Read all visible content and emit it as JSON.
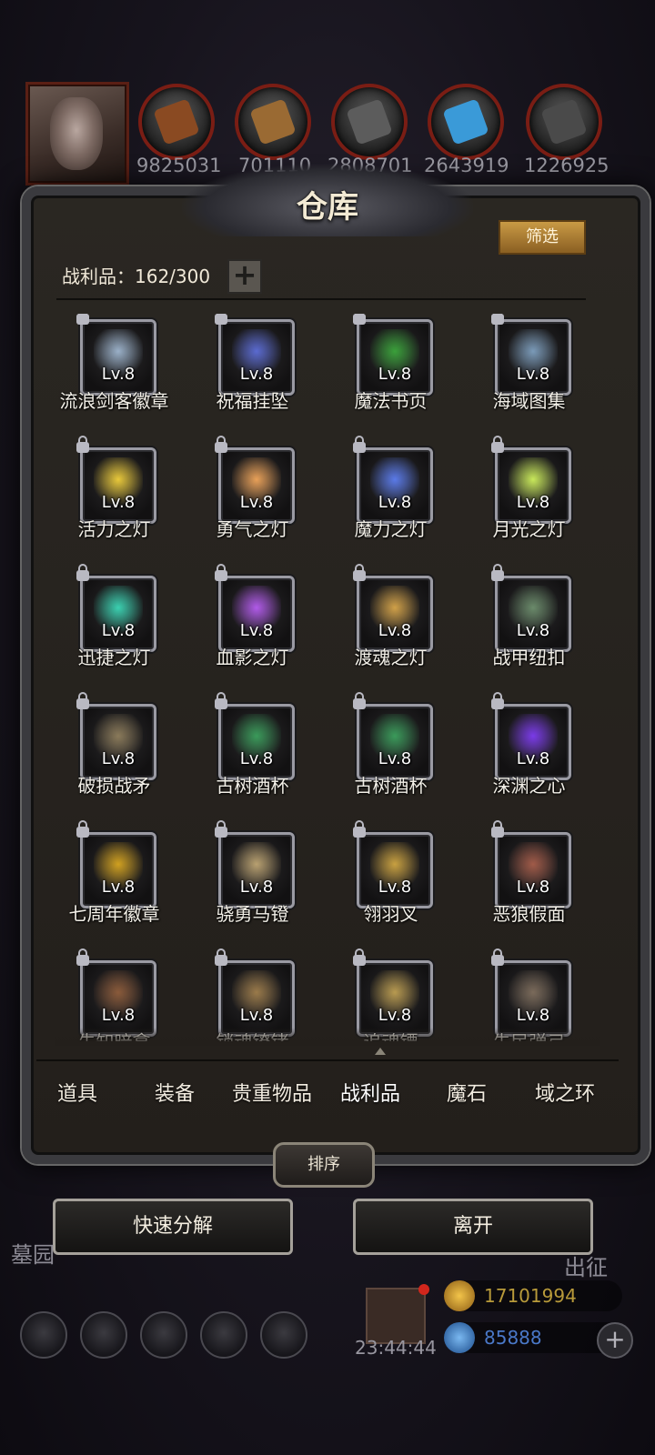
{
  "resources": [
    {
      "name": "meat-icon",
      "value": "9825031",
      "color": "#8a4a22"
    },
    {
      "name": "wood-icon",
      "value": "701110",
      "color": "#9a6a33"
    },
    {
      "name": "iron-icon",
      "value": "2808701",
      "color": "#5c5c5c"
    },
    {
      "name": "crystal-icon",
      "value": "2643919",
      "color": "#3a9ad8"
    },
    {
      "name": "steel-icon",
      "value": "1226925",
      "color": "#4a4a4a"
    }
  ],
  "panel": {
    "title": "仓库",
    "filter_label": "筛选",
    "count_label": "战利品：162/300",
    "plus_label": "+"
  },
  "items": [
    {
      "name": "流浪剑客徽章",
      "level": "Lv.8",
      "icon": "badge-icon",
      "color": "#9ab0c8"
    },
    {
      "name": "祝福挂坠",
      "level": "Lv.8",
      "icon": "pendant-icon",
      "color": "#5a6ad0"
    },
    {
      "name": "魔法书页",
      "level": "Lv.8",
      "icon": "spell-page-icon",
      "color": "#3aa03a"
    },
    {
      "name": "海域图集",
      "level": "Lv.8",
      "icon": "atlas-icon",
      "color": "#7a9ab8"
    },
    {
      "name": "活力之灯",
      "level": "Lv.8",
      "icon": "lantern-icon",
      "color": "#e8c83a"
    },
    {
      "name": "勇气之灯",
      "level": "Lv.8",
      "icon": "lantern-icon",
      "color": "#e8a058"
    },
    {
      "name": "魔力之灯",
      "level": "Lv.8",
      "icon": "lantern-icon",
      "color": "#5a7ae8"
    },
    {
      "name": "月光之灯",
      "level": "Lv.8",
      "icon": "lantern-icon",
      "color": "#c8e85a"
    },
    {
      "name": "迅捷之灯",
      "level": "Lv.8",
      "icon": "lantern-icon",
      "color": "#3ad0b0"
    },
    {
      "name": "血影之灯",
      "level": "Lv.8",
      "icon": "lantern-icon",
      "color": "#b05ae8"
    },
    {
      "name": "渡魂之灯",
      "level": "Lv.8",
      "icon": "lantern-icon",
      "color": "#d0a048"
    },
    {
      "name": "战甲纽扣",
      "level": "Lv.8",
      "icon": "armor-button-icon",
      "color": "#6a8a6a"
    },
    {
      "name": "破损战矛",
      "level": "Lv.8",
      "icon": "spear-icon",
      "color": "#8a7a5a"
    },
    {
      "name": "古树酒杯",
      "level": "Lv.8",
      "icon": "goblet-icon",
      "color": "#3a9a5a"
    },
    {
      "name": "古树酒杯",
      "level": "Lv.8",
      "icon": "goblet-icon",
      "color": "#3a9a5a"
    },
    {
      "name": "深渊之心",
      "level": "Lv.8",
      "icon": "abyss-heart-icon",
      "color": "#7a3ae8"
    },
    {
      "name": "七周年徽章",
      "level": "Lv.8",
      "icon": "anniversary-badge-icon",
      "color": "#d0a020"
    },
    {
      "name": "骁勇马镫",
      "level": "Lv.8",
      "icon": "stirrup-icon",
      "color": "#b8a070"
    },
    {
      "name": "翎羽叉",
      "level": "Lv.8",
      "icon": "fork-icon",
      "color": "#c8a040"
    },
    {
      "name": "恶狼假面",
      "level": "Lv.8",
      "icon": "wolf-mask-icon",
      "color": "#a05a48"
    },
    {
      "name": "先知暗拿",
      "level": "Lv.8",
      "icon": "tome-icon",
      "color": "#8a5a3a"
    },
    {
      "name": "锁魂镣铐",
      "level": "Lv.8",
      "icon": "shackle-icon",
      "color": "#9a7a4a"
    },
    {
      "name": "追魂镖",
      "level": "Lv.8",
      "icon": "dart-icon",
      "color": "#b89a50"
    },
    {
      "name": "先民弹弓",
      "level": "Lv.8",
      "icon": "slingshot-icon",
      "color": "#7a6a5a"
    }
  ],
  "tabs": [
    {
      "label": "道具"
    },
    {
      "label": "装备"
    },
    {
      "label": "贵重物品"
    },
    {
      "label": "战利品"
    },
    {
      "label": "魔石"
    },
    {
      "label": "域之环"
    }
  ],
  "active_tab": "战利品",
  "sort_label": "排序",
  "actions": {
    "decompose_label": "快速分解",
    "leave_label": "离开"
  },
  "background": {
    "left_label": "墓园",
    "right_label": "出征",
    "timer": "23:44:44"
  },
  "currencies": [
    {
      "name": "gold-icon",
      "value": "17101994",
      "color": "#d8a030"
    },
    {
      "name": "gem-icon",
      "value": "85888",
      "color": "#4a90e0"
    }
  ],
  "currency_add": "+"
}
